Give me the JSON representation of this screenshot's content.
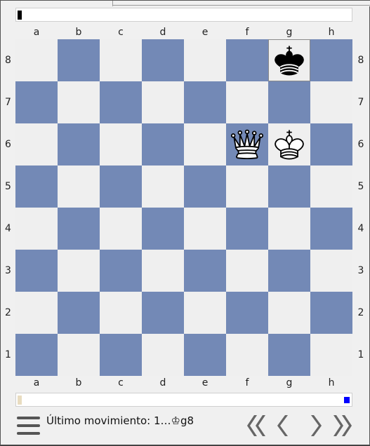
{
  "colors": {
    "light_square": "#efefef",
    "dark_square": "#7389b6",
    "clock_top_indicator": "#000000",
    "clock_bottom_indicator": "#e8dcc0",
    "turn_marker": "#0000ff"
  },
  "board": {
    "files": [
      "a",
      "b",
      "c",
      "d",
      "e",
      "f",
      "g",
      "h"
    ],
    "ranks": [
      "8",
      "7",
      "6",
      "5",
      "4",
      "3",
      "2",
      "1"
    ],
    "last_move_square": "g8",
    "pieces": [
      {
        "square": "g8",
        "piece": "black-king",
        "glyph": "♚"
      },
      {
        "square": "f6",
        "piece": "white-queen",
        "glyph": "♕"
      },
      {
        "square": "g6",
        "piece": "white-king",
        "glyph": "♔"
      }
    ]
  },
  "status": {
    "last_move": "Último movimiento: 1…♔g8"
  },
  "controls": {
    "menu_icon": "hamburger-icon",
    "first_icon": "double-chevron-left-icon",
    "prev_icon": "chevron-left-icon",
    "next_icon": "chevron-right-icon",
    "last_icon": "double-chevron-right-icon"
  }
}
